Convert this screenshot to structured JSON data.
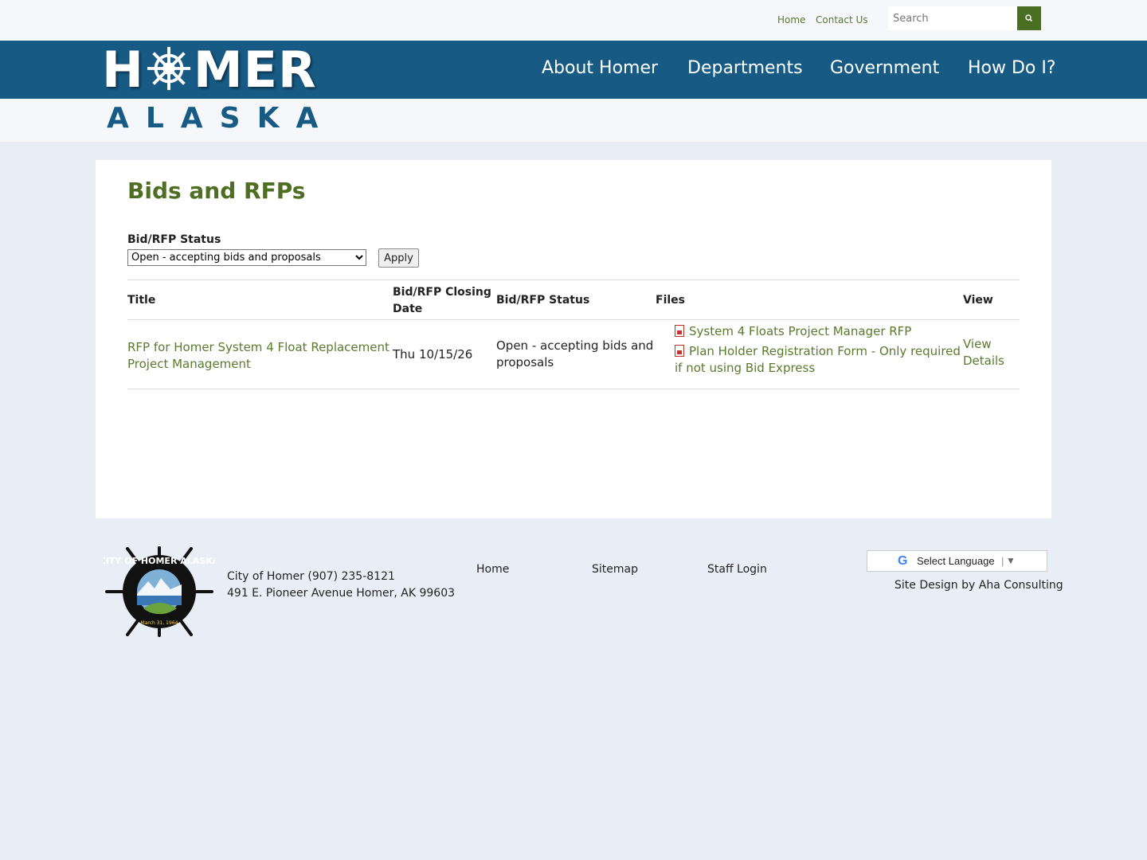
{
  "utility": {
    "links": [
      "Home",
      "Contact Us"
    ],
    "search_placeholder": "Search"
  },
  "logo": {
    "line1_a": "H",
    "line1_b": "MER",
    "line2": "ALASKA"
  },
  "nav": [
    "About Homer",
    "Departments",
    "Government",
    "How Do I?"
  ],
  "page": {
    "title": "Bids and RFPs",
    "filter_label": "Bid/RFP Status",
    "filter_selected": "Open - accepting bids and proposals",
    "apply_label": "Apply"
  },
  "table": {
    "headers": {
      "title": "Title",
      "closing_line1": "Bid/RFP Closing",
      "closing_line2": "Date",
      "status": "Bid/RFP Status",
      "files": "Files",
      "view": "View"
    },
    "rows": [
      {
        "title_line1": "RFP for Homer System 4 Float Replacement",
        "title_line2": "Project Management",
        "closing": "Thu 10/15/26",
        "status_line1": "Open - accepting bids and",
        "status_line2": "proposals",
        "file1": "System 4 Floats Project Manager RFP",
        "file2_line1": "Plan Holder Registration Form - Only required",
        "file2_line2": "if not using Bid Express",
        "view_line1": "View",
        "view_line2": "Details"
      }
    ]
  },
  "footer": {
    "contact_line1": "City of Homer (907) 235-8121",
    "contact_line2": "491 E. Pioneer Avenue Homer, AK 99603",
    "links": [
      "Home",
      "Sitemap",
      "Staff Login"
    ],
    "language_label": "Select Language",
    "credit": "Site Design by Aha Consulting",
    "seal_text": "CITY OF HOMER ALASKA",
    "seal_date": "March 31, 1964"
  },
  "colors": {
    "nav_blue": "#175b85",
    "link_green": "#5a7a2e",
    "title_green": "#4e6e22",
    "page_bg": "#e9eef6"
  }
}
